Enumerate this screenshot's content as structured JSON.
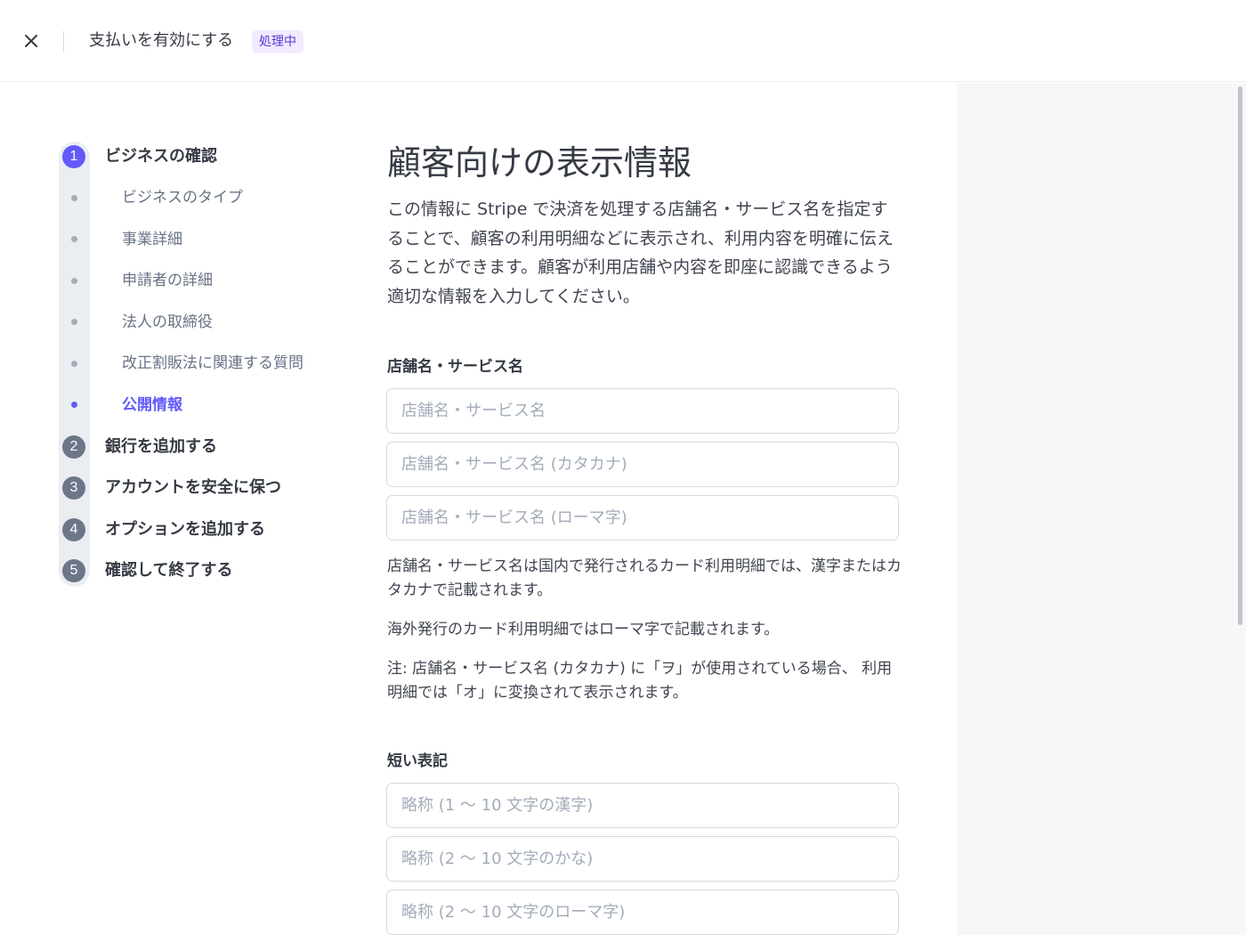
{
  "header": {
    "title": "支払いを有効にする",
    "status_badge": "処理中"
  },
  "stepper": {
    "steps": [
      {
        "number": "1",
        "label": "ビジネスの確認",
        "state": "active"
      },
      {
        "number": "2",
        "label": "銀行を追加する",
        "state": "pending"
      },
      {
        "number": "3",
        "label": "アカウントを安全に保つ",
        "state": "pending"
      },
      {
        "number": "4",
        "label": "オプションを追加する",
        "state": "pending"
      },
      {
        "number": "5",
        "label": "確認して終了する",
        "state": "pending"
      }
    ],
    "substeps": [
      {
        "label": "ビジネスのタイプ",
        "active": false
      },
      {
        "label": "事業詳細",
        "active": false
      },
      {
        "label": "申請者の詳細",
        "active": false
      },
      {
        "label": "法人の取締役",
        "active": false
      },
      {
        "label": "改正割販法に関連する質問",
        "active": false
      },
      {
        "label": "公開情報",
        "active": true
      }
    ]
  },
  "main": {
    "title": "顧客向けの表示情報",
    "intro": "この情報に Stripe で決済を処理する店舗名・サービス名を指定することで、顧客の利用明細などに表示され、利用内容を明確に伝えることができます。顧客が利用店舗や内容を即座に認識できるよう適切な情報を入力してください。",
    "store_name": {
      "label": "店舗名・サービス名",
      "inputs": [
        {
          "placeholder": "店舗名・サービス名",
          "value": ""
        },
        {
          "placeholder": "店舗名・サービス名 (カタカナ)",
          "value": ""
        },
        {
          "placeholder": "店舗名・サービス名 (ローマ字)",
          "value": ""
        }
      ],
      "help": [
        "店舗名・サービス名は国内で発行されるカード利用明細では、漢字またはカタカナで記載されます。",
        "海外発行のカード利用明細ではローマ字で記載されます。",
        "注: 店舗名・サービス名 (カタカナ) に「ヲ」が使用されている場合、 利用明細では「オ」に変換されて表示されます。"
      ]
    },
    "short_name": {
      "label": "短い表記",
      "inputs": [
        {
          "placeholder": "略称 (1 〜 10 文字の漢字)",
          "value": ""
        },
        {
          "placeholder": "略称 (2 〜 10 文字のかな)",
          "value": ""
        },
        {
          "placeholder": "略称 (2 〜 10 文字のローマ字)",
          "value": ""
        }
      ]
    }
  },
  "icons": {
    "close": "close-icon"
  },
  "colors": {
    "accent": "#625afa",
    "badge_bg": "#f2ebff",
    "badge_text": "#5b35d5",
    "pending_step": "#6c7688"
  }
}
